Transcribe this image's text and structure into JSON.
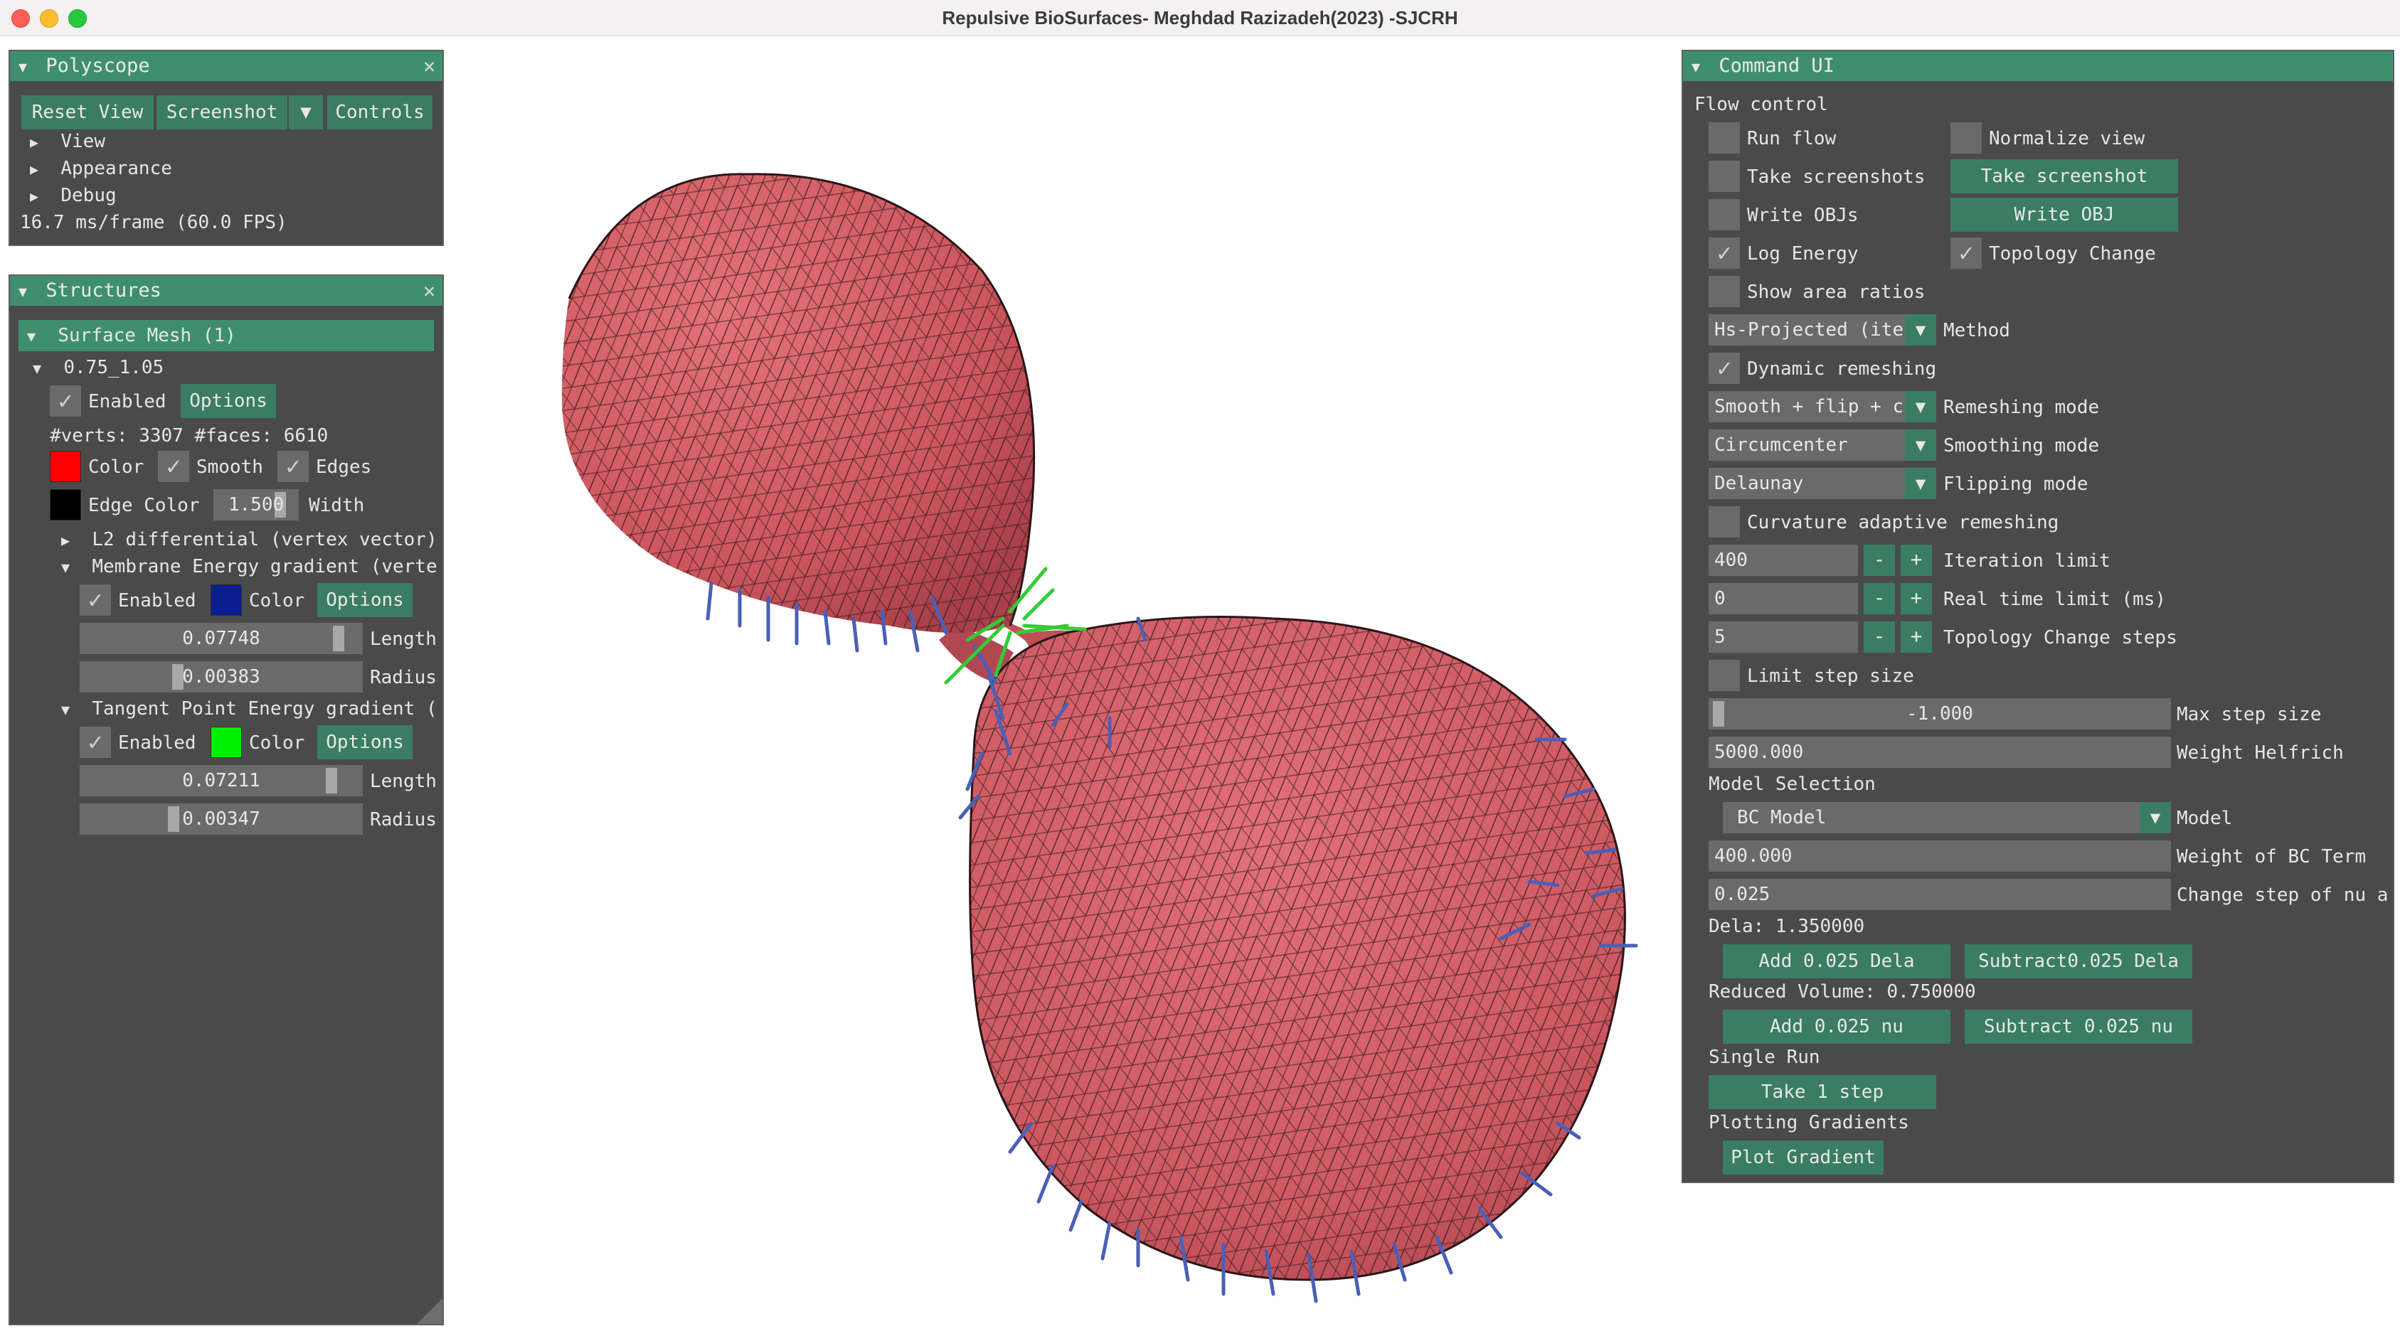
{
  "window": {
    "title": "Repulsive BioSurfaces- Meghdad Razizadeh(2023) -SJCRH"
  },
  "polyscope": {
    "title": "Polyscope",
    "reset_view": "Reset View",
    "screenshot": "Screenshot",
    "controls": "Controls",
    "tree": [
      "View",
      "Appearance",
      "Debug"
    ],
    "fps": "16.7 ms/frame (60.0 FPS)"
  },
  "structures": {
    "title": "Structures",
    "surface_mesh_header": "Surface Mesh (1)",
    "mesh_name": "0.75_1.05",
    "enabled": "Enabled",
    "options": "Options",
    "verts_faces": "#verts: 3307  #faces: 6610",
    "color": "Color",
    "smooth": "Smooth",
    "edges": "Edges",
    "edge_color": "Edge Color",
    "edge_width_value": "1.500",
    "width": "Width",
    "l2": "L2 differential (vertex vector)",
    "membrane": "Membrane Energy gradient (verte:",
    "membrane_enabled": "Enabled",
    "membrane_color": "Color",
    "membrane_options": "Options",
    "membrane_length_value": "0.07748",
    "membrane_length_fill": 0.9,
    "length": "Length",
    "membrane_radius_value": "0.00383",
    "membrane_radius_fill": 0.35,
    "radius": "Radius",
    "tangent": "Tangent Point Energy gradient (v",
    "tangent_enabled": "Enabled",
    "tangent_color": "Color",
    "tangent_options": "Options",
    "tangent_length_value": "0.07211",
    "tangent_length_fill": 0.87,
    "tangent_radius_value": "0.00347",
    "tangent_radius_fill": 0.33,
    "colors": {
      "mesh": "#ff0000",
      "edge": "#000000",
      "membrane": "#0a1f8f",
      "tangent": "#00ee00"
    }
  },
  "command_ui": {
    "title": "Command UI",
    "flow_control": "Flow control",
    "run_flow": "Run flow",
    "normalize_view": "Normalize view",
    "take_screenshots": "Take screenshots",
    "take_screenshot_btn": "Take screenshot",
    "write_objs": "Write OBJs",
    "write_obj_btn": "Write OBJ",
    "log_energy": "Log Energy",
    "topology_change": "Topology Change",
    "show_area_ratios": "Show area ratios",
    "method_value": "Hs-Projected (ite",
    "method_label": "Method",
    "dynamic_remeshing": "Dynamic remeshing",
    "remeshing_value": "Smooth + flip + c",
    "remeshing_label": "Remeshing mode",
    "smoothing_value": "Circumcenter",
    "smoothing_label": "Smoothing mode",
    "flipping_value": "Delaunay",
    "flipping_label": "Flipping mode",
    "curvature_adaptive": "Curvature adaptive remeshing",
    "iteration_value": "400",
    "iteration_label": "Iteration limit",
    "realtime_value": "0",
    "realtime_label": "Real time limit (ms)",
    "topo_steps_value": "5",
    "topo_steps_label": "Topology Change steps",
    "minus": "-",
    "plus": "+",
    "limit_step_size": "Limit step size",
    "max_step_value": "-1.000",
    "max_step_label": "Max step size",
    "helfrich_value": "5000.000",
    "helfrich_label": "Weight Helfrich",
    "model_selection": "Model Selection",
    "model_value": "BC Model",
    "model_label": "Model",
    "bc_weight_value": "400.000",
    "bc_weight_label": "Weight of BC Term",
    "nu_step_value": "0.025",
    "nu_step_label": "Change step of nu a",
    "dela": "Dela: 1.350000",
    "add_dela": "Add 0.025 Dela",
    "sub_dela": "Subtract0.025 Dela",
    "reduced_volume": "Reduced Volume: 0.750000",
    "add_nu": "Add 0.025 nu",
    "sub_nu": "Subtract 0.025 nu",
    "single_run": "Single Run",
    "take_step": "Take 1 step",
    "plotting_gradients": "Plotting Gradients",
    "plot_gradient": "Plot Gradient"
  },
  "icons": {
    "check": "✓",
    "tri_down": "▼",
    "tri_right": "▶",
    "close": "✕",
    "dd": "▼"
  }
}
